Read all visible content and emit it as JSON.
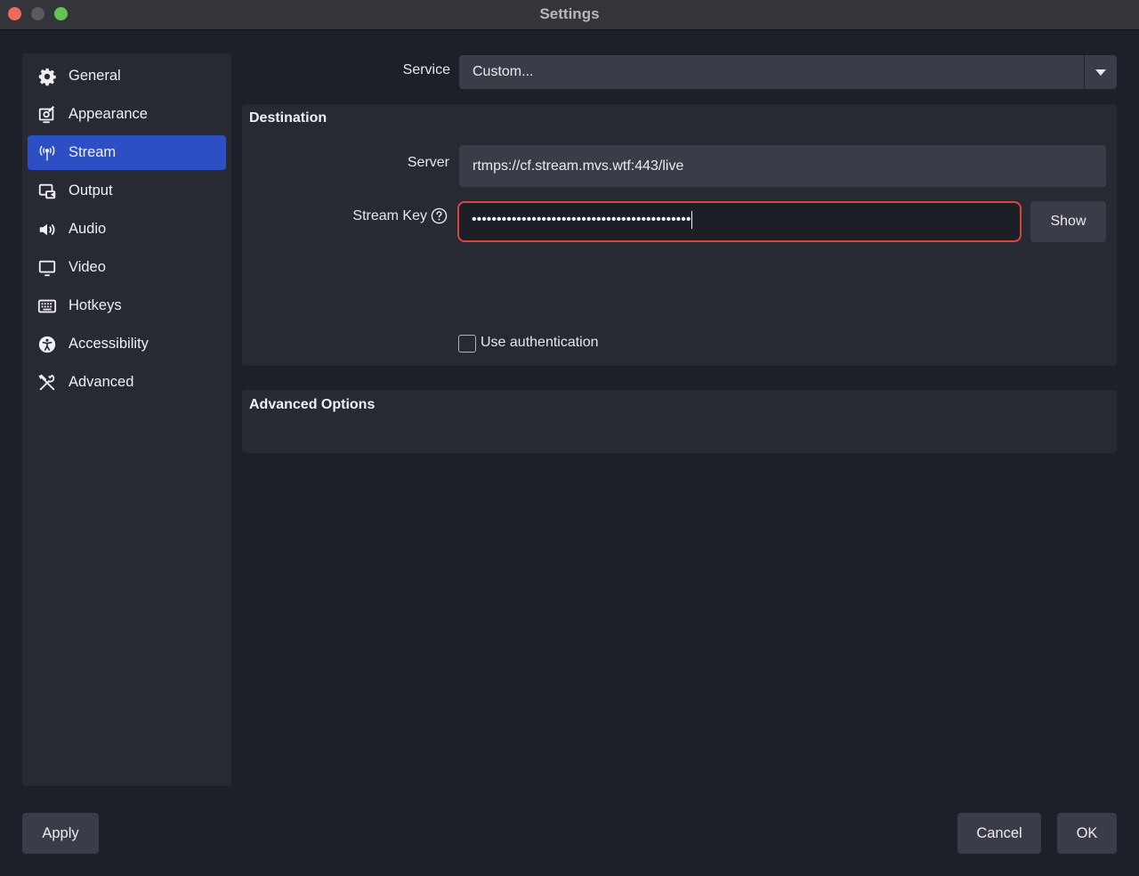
{
  "window": {
    "title": "Settings"
  },
  "sidebar": {
    "items": [
      {
        "label": "General",
        "icon": "gear-icon"
      },
      {
        "label": "Appearance",
        "icon": "appearance-icon"
      },
      {
        "label": "Stream",
        "icon": "antenna-icon",
        "active": true
      },
      {
        "label": "Output",
        "icon": "output-icon"
      },
      {
        "label": "Audio",
        "icon": "speaker-icon"
      },
      {
        "label": "Video",
        "icon": "monitor-icon"
      },
      {
        "label": "Hotkeys",
        "icon": "keyboard-icon"
      },
      {
        "label": "Accessibility",
        "icon": "accessibility-icon"
      },
      {
        "label": "Advanced",
        "icon": "tools-icon"
      }
    ]
  },
  "service": {
    "label": "Service",
    "value": "Custom..."
  },
  "destination": {
    "title": "Destination",
    "server_label": "Server",
    "server_value": "rtmps://cf.stream.mvs.wtf:443/live",
    "stream_key_label": "Stream Key",
    "stream_key_value": "••••••••••••••••••••••••••••••••••••••••••••",
    "show_label": "Show",
    "use_auth_label": "Use authentication",
    "use_auth_checked": false
  },
  "advanced_options": {
    "title": "Advanced Options"
  },
  "footer": {
    "apply_label": "Apply",
    "cancel_label": "Cancel",
    "ok_label": "OK"
  },
  "colors": {
    "accent": "#2c4fc4",
    "focus_border": "#d9453a",
    "background": "#1e2029",
    "panel": "#272a33"
  }
}
